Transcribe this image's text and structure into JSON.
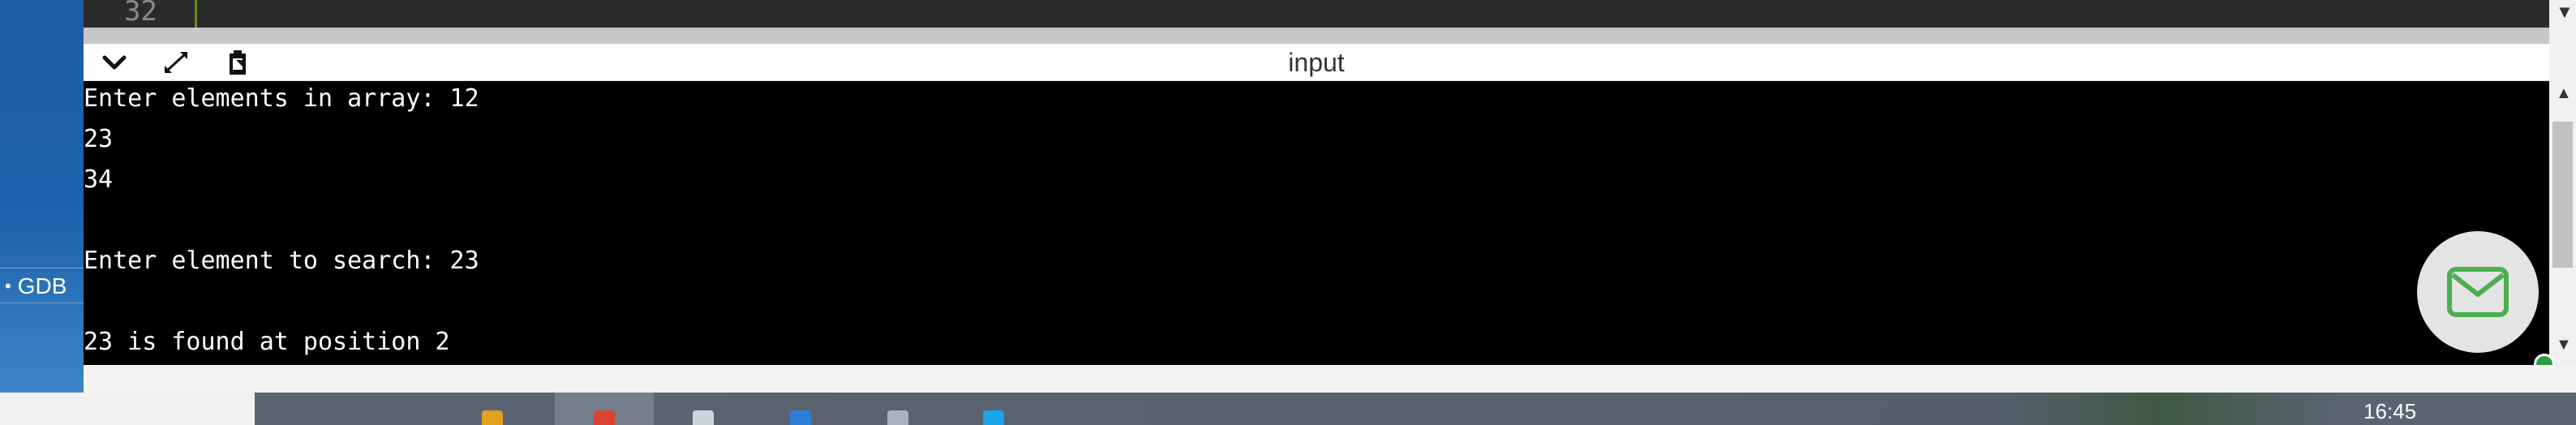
{
  "editor": {
    "line_number": "32"
  },
  "sidebar": {
    "gdb_label": "GDB",
    "bullet": "•"
  },
  "panel": {
    "title": "input"
  },
  "terminal": {
    "lines": [
      "Enter elements in array: 12",
      "23",
      "34",
      "",
      "Enter element to search: 23",
      "",
      "23 is found at position 2"
    ]
  },
  "taskbar": {
    "clock": "16:45"
  },
  "icons": {
    "collapse": "chevron-down-icon",
    "expand": "expand-arrows-icon",
    "copy": "clipboard-copy-icon",
    "mail": "mail-icon"
  },
  "colors": {
    "sidebar": "#1d63ad",
    "terminal_bg": "#000000",
    "terminal_fg": "#ffffff",
    "mail_icon": "#4caf50",
    "gutter": "#6b8e23"
  }
}
